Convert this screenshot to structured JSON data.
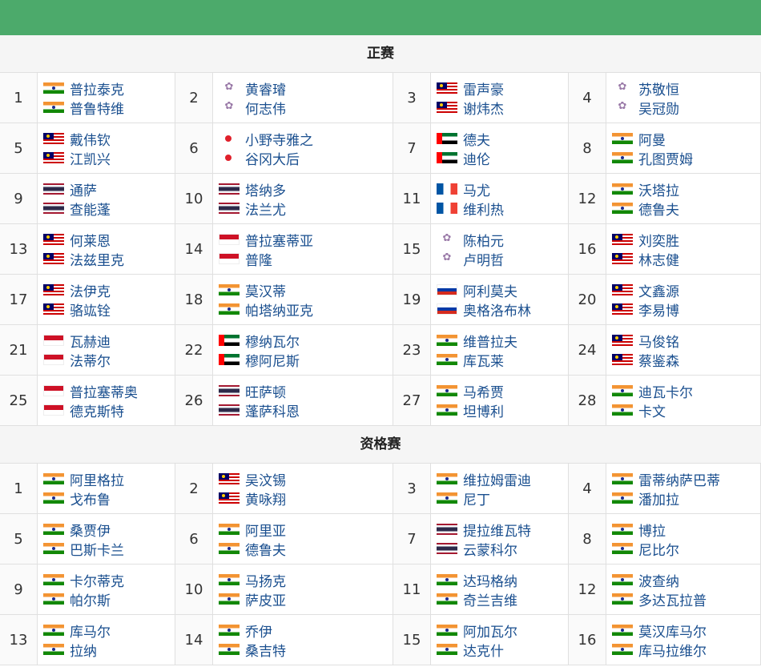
{
  "main_draw": {
    "title": "正赛",
    "entries": [
      {
        "num": "1",
        "players": [
          {
            "flag": "india",
            "name": "普拉泰克"
          },
          {
            "flag": "india",
            "name": "普鲁特维"
          }
        ]
      },
      {
        "num": "2",
        "players": [
          {
            "flag": "tpe",
            "name": "黄睿璿"
          },
          {
            "flag": "tpe",
            "name": "何志伟"
          }
        ]
      },
      {
        "num": "3",
        "players": [
          {
            "flag": "malaysia",
            "name": "雷声豪"
          },
          {
            "flag": "malaysia",
            "name": "谢炜杰"
          }
        ]
      },
      {
        "num": "4",
        "players": [
          {
            "flag": "tpe",
            "name": "苏敬恒"
          },
          {
            "flag": "tpe",
            "name": "吴冠勋"
          }
        ]
      },
      {
        "num": "5",
        "players": [
          {
            "flag": "malaysia",
            "name": "戴伟钦"
          },
          {
            "flag": "malaysia",
            "name": "江凯兴"
          }
        ]
      },
      {
        "num": "6",
        "players": [
          {
            "flag": "japan",
            "name": "小野寺雅之"
          },
          {
            "flag": "japan",
            "name": "谷冈大后"
          }
        ]
      },
      {
        "num": "7",
        "players": [
          {
            "flag": "uae",
            "name": "德夫"
          },
          {
            "flag": "uae",
            "name": "迪伦"
          }
        ]
      },
      {
        "num": "8",
        "players": [
          {
            "flag": "india",
            "name": "阿曼"
          },
          {
            "flag": "india",
            "name": "孔图贾姆"
          }
        ]
      },
      {
        "num": "9",
        "players": [
          {
            "flag": "thailand",
            "name": "通萨"
          },
          {
            "flag": "thailand",
            "name": "查能蓬"
          }
        ]
      },
      {
        "num": "10",
        "players": [
          {
            "flag": "thailand",
            "name": "塔纳多"
          },
          {
            "flag": "thailand",
            "name": "法兰尤"
          }
        ]
      },
      {
        "num": "11",
        "players": [
          {
            "flag": "france",
            "name": "马尤"
          },
          {
            "flag": "france",
            "name": "维利热"
          }
        ]
      },
      {
        "num": "12",
        "players": [
          {
            "flag": "india",
            "name": "沃塔拉"
          },
          {
            "flag": "india",
            "name": "德鲁夫"
          }
        ]
      },
      {
        "num": "13",
        "players": [
          {
            "flag": "malaysia",
            "name": "何莱恩"
          },
          {
            "flag": "malaysia",
            "name": "法兹里克"
          }
        ]
      },
      {
        "num": "14",
        "players": [
          {
            "flag": "indonesia",
            "name": "普拉塞蒂亚"
          },
          {
            "flag": "indonesia",
            "name": "普隆"
          }
        ]
      },
      {
        "num": "15",
        "players": [
          {
            "flag": "tpe",
            "name": "陈柏元"
          },
          {
            "flag": "tpe",
            "name": "卢明哲"
          }
        ]
      },
      {
        "num": "16",
        "players": [
          {
            "flag": "malaysia",
            "name": "刘奕胜"
          },
          {
            "flag": "malaysia",
            "name": "林志健"
          }
        ]
      },
      {
        "num": "17",
        "players": [
          {
            "flag": "malaysia",
            "name": "法伊克"
          },
          {
            "flag": "malaysia",
            "name": "骆竑铨"
          }
        ]
      },
      {
        "num": "18",
        "players": [
          {
            "flag": "india",
            "name": "莫汉蒂"
          },
          {
            "flag": "india",
            "name": "帕塔纳亚克"
          }
        ]
      },
      {
        "num": "19",
        "players": [
          {
            "flag": "russia",
            "name": "阿利莫夫"
          },
          {
            "flag": "russia",
            "name": "奥格洛布林"
          }
        ]
      },
      {
        "num": "20",
        "players": [
          {
            "flag": "malaysia",
            "name": "文鑫源"
          },
          {
            "flag": "malaysia",
            "name": "李易博"
          }
        ]
      },
      {
        "num": "21",
        "players": [
          {
            "flag": "indonesia",
            "name": "瓦赫迪"
          },
          {
            "flag": "indonesia",
            "name": "法蒂尔"
          }
        ]
      },
      {
        "num": "22",
        "players": [
          {
            "flag": "uae",
            "name": "穆纳瓦尔"
          },
          {
            "flag": "uae",
            "name": "穆阿尼斯"
          }
        ]
      },
      {
        "num": "23",
        "players": [
          {
            "flag": "india",
            "name": "维普拉夫"
          },
          {
            "flag": "india",
            "name": "库瓦莱"
          }
        ]
      },
      {
        "num": "24",
        "players": [
          {
            "flag": "malaysia",
            "name": "马俊铭"
          },
          {
            "flag": "malaysia",
            "name": "蔡鉴森"
          }
        ]
      },
      {
        "num": "25",
        "players": [
          {
            "flag": "indonesia",
            "name": "普拉塞蒂奥"
          },
          {
            "flag": "indonesia",
            "name": "德克斯特"
          }
        ]
      },
      {
        "num": "26",
        "players": [
          {
            "flag": "thailand",
            "name": "旺萨顿"
          },
          {
            "flag": "thailand",
            "name": "蓬萨科恩"
          }
        ]
      },
      {
        "num": "27",
        "players": [
          {
            "flag": "india",
            "name": "马希贾"
          },
          {
            "flag": "india",
            "name": "坦博利"
          }
        ]
      },
      {
        "num": "28",
        "players": [
          {
            "flag": "india",
            "name": "迪瓦卡尔"
          },
          {
            "flag": "india",
            "name": "卡文"
          }
        ]
      }
    ]
  },
  "qualifying": {
    "title": "资格赛",
    "entries": [
      {
        "num": "1",
        "players": [
          {
            "flag": "india",
            "name": "阿里格拉"
          },
          {
            "flag": "india",
            "name": "戈布鲁"
          }
        ]
      },
      {
        "num": "2",
        "players": [
          {
            "flag": "malaysia",
            "name": "吴汶锡"
          },
          {
            "flag": "malaysia",
            "name": "黄咏翔"
          }
        ]
      },
      {
        "num": "3",
        "players": [
          {
            "flag": "india",
            "name": "维拉姆雷迪"
          },
          {
            "flag": "india",
            "name": "尼丁"
          }
        ]
      },
      {
        "num": "4",
        "players": [
          {
            "flag": "india",
            "name": "雷蒂纳萨巴蒂"
          },
          {
            "flag": "india",
            "name": "潘加拉"
          }
        ]
      },
      {
        "num": "5",
        "players": [
          {
            "flag": "india",
            "name": "桑贾伊"
          },
          {
            "flag": "india",
            "name": "巴斯卡兰"
          }
        ]
      },
      {
        "num": "6",
        "players": [
          {
            "flag": "india",
            "name": "阿里亚"
          },
          {
            "flag": "india",
            "name": "德鲁夫"
          }
        ]
      },
      {
        "num": "7",
        "players": [
          {
            "flag": "thailand",
            "name": "提拉维瓦特"
          },
          {
            "flag": "thailand",
            "name": "云蒙科尔"
          }
        ]
      },
      {
        "num": "8",
        "players": [
          {
            "flag": "india",
            "name": "博拉"
          },
          {
            "flag": "india",
            "name": "尼比尔"
          }
        ]
      },
      {
        "num": "9",
        "players": [
          {
            "flag": "india",
            "name": "卡尔蒂克"
          },
          {
            "flag": "india",
            "name": "帕尔斯"
          }
        ]
      },
      {
        "num": "10",
        "players": [
          {
            "flag": "india",
            "name": "马扬克"
          },
          {
            "flag": "india",
            "name": "萨皮亚"
          }
        ]
      },
      {
        "num": "11",
        "players": [
          {
            "flag": "india",
            "name": "达玛格纳"
          },
          {
            "flag": "india",
            "name": "奇兰吉维"
          }
        ]
      },
      {
        "num": "12",
        "players": [
          {
            "flag": "india",
            "name": "波查纳"
          },
          {
            "flag": "india",
            "name": "多达瓦拉普"
          }
        ]
      },
      {
        "num": "13",
        "players": [
          {
            "flag": "india",
            "name": "库马尔"
          },
          {
            "flag": "india",
            "name": "拉纳"
          }
        ]
      },
      {
        "num": "14",
        "players": [
          {
            "flag": "india",
            "name": "乔伊"
          },
          {
            "flag": "india",
            "name": "桑吉特"
          }
        ]
      },
      {
        "num": "15",
        "players": [
          {
            "flag": "india",
            "name": "阿加瓦尔"
          },
          {
            "flag": "india",
            "name": "达克什"
          }
        ]
      },
      {
        "num": "16",
        "players": [
          {
            "flag": "india",
            "name": "莫汉库马尔"
          },
          {
            "flag": "india",
            "name": "库马拉维尔"
          }
        ]
      }
    ]
  }
}
